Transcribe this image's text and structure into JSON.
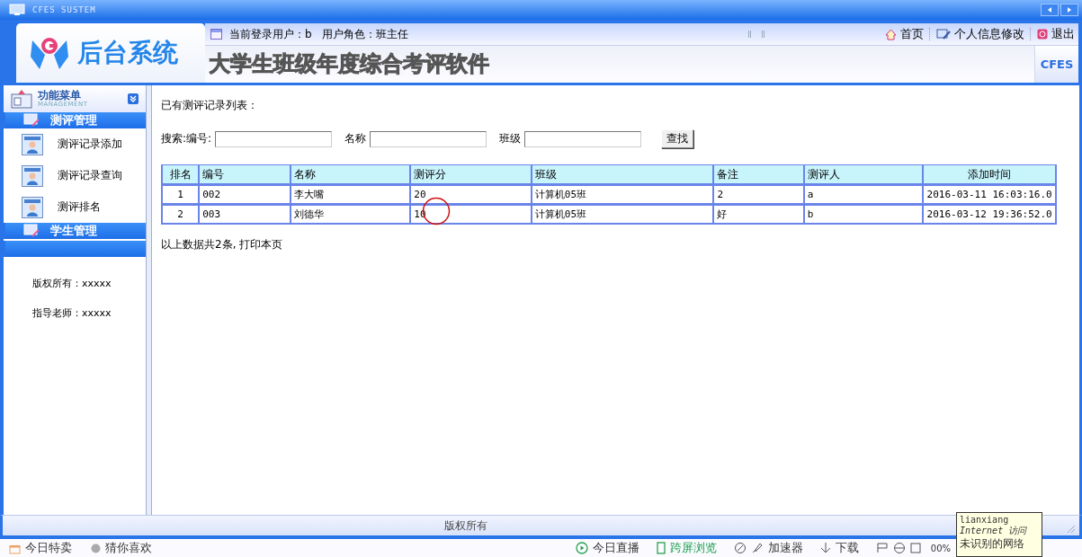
{
  "window": {
    "title": "CFES SUSTEM"
  },
  "header": {
    "logo_text": "后台系统",
    "user_info": "当前登录用户：b   用户角色：班主任",
    "links": [
      "首页",
      "个人信息修改",
      "退出"
    ],
    "app_title": "大学生班级年度综合考评软件",
    "badge": "CFES"
  },
  "sidebar": {
    "title": "功能菜单",
    "subtitle": "MANAGEMENT",
    "sections": [
      {
        "title": "测评管理",
        "items": [
          "测评记录添加",
          "测评记录查询",
          "测评排名"
        ]
      },
      {
        "title": "学生管理"
      }
    ],
    "credits": [
      "版权所有：xxxxx",
      "指导老师：xxxxx"
    ]
  },
  "content": {
    "heading": "已有测评记录列表：",
    "search": {
      "fields": [
        {
          "label": "搜索:编号:"
        },
        {
          "label": "名称"
        },
        {
          "label": "班级"
        }
      ],
      "button": "查找"
    },
    "table": {
      "columns": [
        "排名",
        "编号",
        "名称",
        "测评分",
        "班级",
        "备注",
        "测评人",
        "添加时间"
      ],
      "rows": [
        [
          "1",
          "002",
          "李大嘴",
          "20",
          "计算机05班",
          "2",
          "a",
          "2016-03-11 16:03:16.0"
        ],
        [
          "2",
          "003",
          "刘德华",
          "10",
          "计算机05班",
          "好",
          "b",
          "2016-03-12 19:36:52.0"
        ]
      ]
    },
    "summary": "以上数据共2条, 打印本页"
  },
  "footer": "版权所有",
  "status_bar": {
    "left": [
      "今日特卖",
      "猜你喜欢"
    ],
    "right": [
      {
        "label": "今日直播",
        "highlighted": false
      },
      {
        "label": "跨屏浏览",
        "highlighted": true
      },
      {
        "label": "加速器",
        "highlighted": false
      },
      {
        "label": "下载",
        "highlighted": false
      }
    ],
    "zoom": "00%"
  },
  "tooltip": {
    "title": "lianxiang",
    "subtitle": "Internet 访问",
    "body": "未识别的网络"
  }
}
